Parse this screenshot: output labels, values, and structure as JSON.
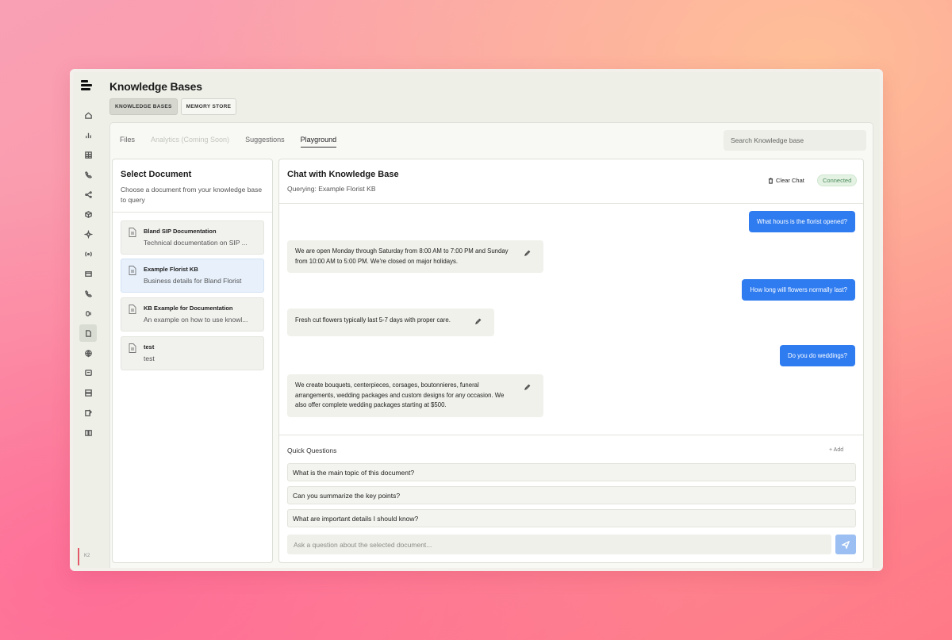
{
  "header": {
    "title": "Knowledge Bases",
    "tabs": [
      {
        "label": "KNOWLEDGE BASES"
      },
      {
        "label": "MEMORY STORE"
      }
    ]
  },
  "sidebar": {
    "icons": [
      "home-icon",
      "analytics-icon",
      "table-icon",
      "phone-icon",
      "share-icon",
      "cube-icon",
      "spark-icon",
      "broadcast-icon",
      "card-icon",
      "call-icon",
      "voice-icon",
      "document-icon",
      "globe-icon",
      "chat-icon",
      "server-icon",
      "edit-icon",
      "book-icon"
    ],
    "footer_label": "K2"
  },
  "subtabs": [
    {
      "label": "Files"
    },
    {
      "label": "Analytics (Coming Soon)"
    },
    {
      "label": "Suggestions"
    },
    {
      "label": "Playground"
    }
  ],
  "search": {
    "placeholder": "Search Knowledge base"
  },
  "doc_panel": {
    "title": "Select Document",
    "description": "Choose a document from your knowledge base to query",
    "documents": [
      {
        "name": "Bland SIP Documentation",
        "subtitle": "Technical documentation on SIP ..."
      },
      {
        "name": "Example Florist KB",
        "subtitle": "Business details for Bland Florist"
      },
      {
        "name": "KB Example for Documentation",
        "subtitle": "An example on how to use knowl..."
      },
      {
        "name": "test",
        "subtitle": "test"
      }
    ]
  },
  "chat": {
    "title": "Chat with Knowledge Base",
    "subtitle": "Querying: Example Florist KB",
    "clear_label": "Clear Chat",
    "status": "Connected",
    "messages": [
      {
        "role": "user",
        "text": "What hours is the florist opened?"
      },
      {
        "role": "bot",
        "text": "We are open Monday through Saturday from 8:00 AM to 7:00 PM and Sunday from 10:00 AM to 5:00 PM. We're closed on major holidays."
      },
      {
        "role": "user",
        "text": "How long will flowers normally last?"
      },
      {
        "role": "bot",
        "text": "Fresh cut flowers typically last 5-7 days with proper care."
      },
      {
        "role": "user",
        "text": "Do you do weddings?"
      },
      {
        "role": "bot",
        "text": "We create bouquets, centerpieces, corsages, boutonnieres, funeral arrangements, wedding packages and custom designs for any occasion. We also offer complete wedding packages starting at $500."
      }
    ],
    "quick_questions": {
      "title": "Quick Questions",
      "add_label": "+ Add",
      "items": [
        "What is the main topic of this document?",
        "Can you summarize the key points?",
        "What are important details I should know?"
      ]
    },
    "input_placeholder": "Ask a question about the selected document..."
  },
  "colors": {
    "accent": "#2f7cf0",
    "selected_doc": "#e7f0fb",
    "status_green": "#4a8a58"
  }
}
